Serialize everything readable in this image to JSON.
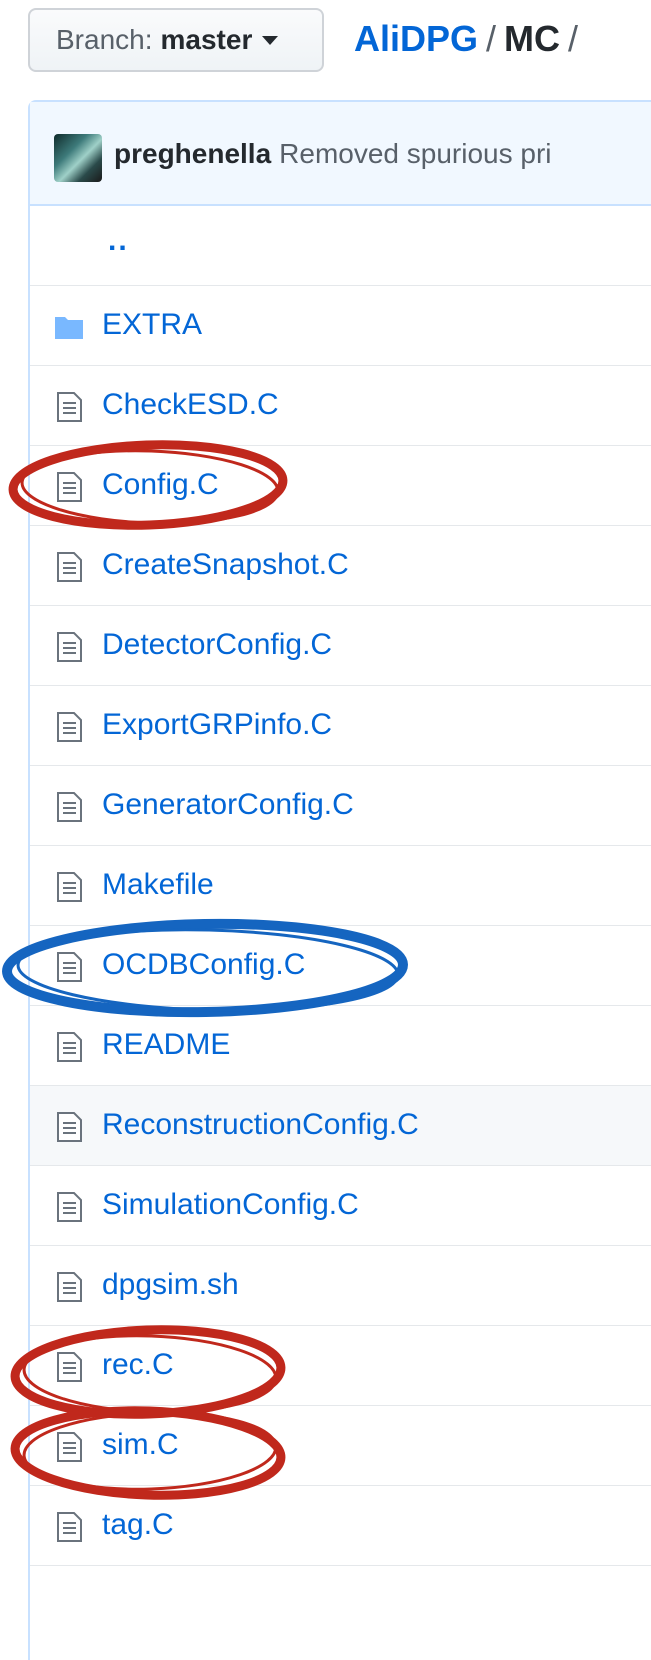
{
  "header": {
    "branch_prefix": "Branch:",
    "branch_name": "master",
    "breadcrumb": {
      "repo": "AliDPG",
      "sep1": "/",
      "dir": "MC",
      "sep2": "/"
    }
  },
  "commit": {
    "author": "preghenella",
    "message": "Removed spurious pri"
  },
  "files": {
    "parent": "..",
    "items": [
      {
        "label": "EXTRA",
        "type": "folder"
      },
      {
        "label": "CheckESD.C",
        "type": "file"
      },
      {
        "label": "Config.C",
        "type": "file"
      },
      {
        "label": "CreateSnapshot.C",
        "type": "file"
      },
      {
        "label": "DetectorConfig.C",
        "type": "file"
      },
      {
        "label": "ExportGRPinfo.C",
        "type": "file"
      },
      {
        "label": "GeneratorConfig.C",
        "type": "file"
      },
      {
        "label": "Makefile",
        "type": "file"
      },
      {
        "label": "OCDBConfig.C",
        "type": "file"
      },
      {
        "label": "README",
        "type": "file"
      },
      {
        "label": "ReconstructionConfig.C",
        "type": "file"
      },
      {
        "label": "SimulationConfig.C",
        "type": "file"
      },
      {
        "label": "dpgsim.sh",
        "type": "file"
      },
      {
        "label": "rec.C",
        "type": "file"
      },
      {
        "label": "sim.C",
        "type": "file"
      },
      {
        "label": "tag.C",
        "type": "file"
      }
    ]
  },
  "colors": {
    "link": "#0366d6",
    "highlight_red": "#c0281c",
    "highlight_blue": "#1565c0"
  }
}
